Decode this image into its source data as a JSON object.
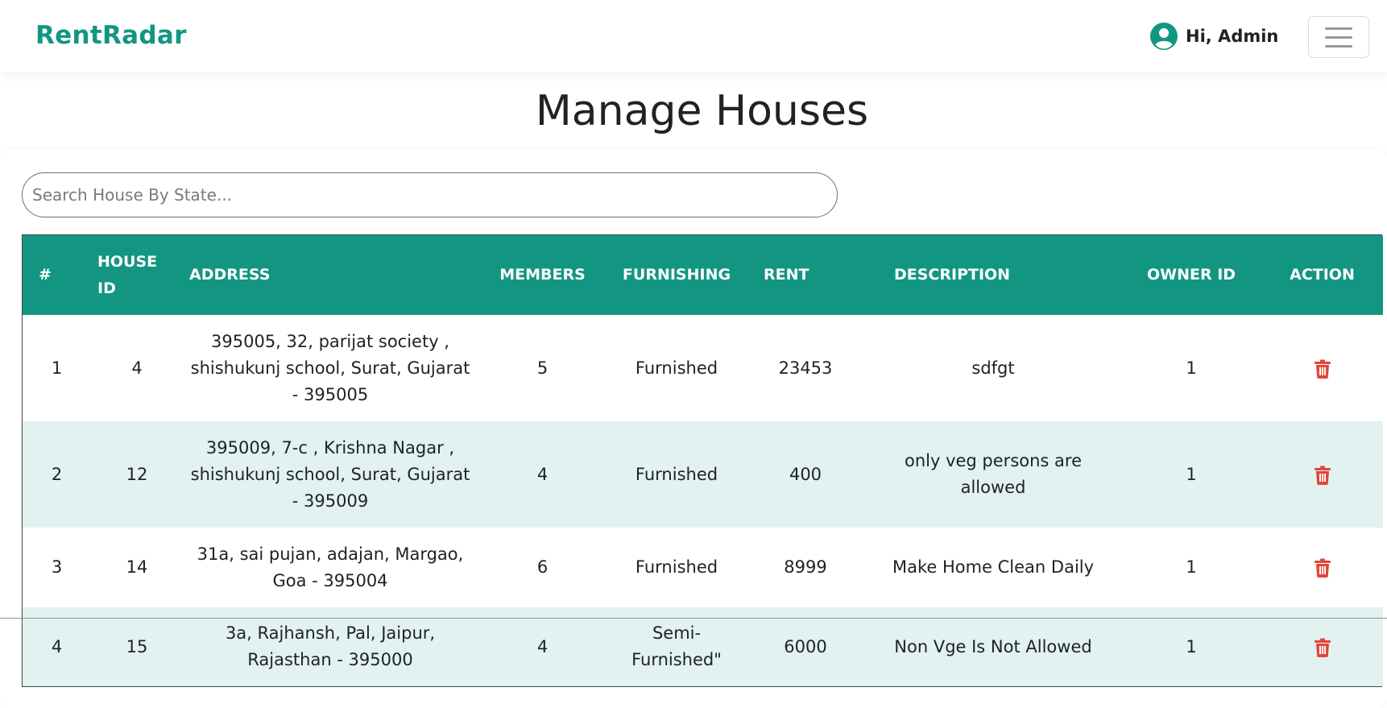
{
  "navbar": {
    "brand": "RentRadar",
    "greeting": "Hi, Admin",
    "user_icon": "user-circle-icon",
    "menu_icon": "hamburger-icon"
  },
  "page": {
    "title": "Manage Houses"
  },
  "search": {
    "placeholder": "Search House By State...",
    "value": ""
  },
  "table": {
    "headers": [
      "#",
      "HOUSE ID",
      "ADDRESS",
      "MEMBERS",
      "FURNISHING",
      "RENT",
      "DESCRIPTION",
      "OWNER ID",
      "ACTION"
    ],
    "rows": [
      {
        "num": "1",
        "house_id": "4",
        "address": "395005, 32, parijat society , shishukunj school, Surat, Gujarat - 395005",
        "members": "5",
        "furnishing": "Furnished",
        "rent": "23453",
        "description": "sdfgt",
        "owner_id": "1",
        "action_icon": "trash-icon"
      },
      {
        "num": "2",
        "house_id": "12",
        "address": "395009, 7-c , Krishna Nagar , shishukunj school, Surat, Gujarat - 395009",
        "members": "4",
        "furnishing": "Furnished",
        "rent": "400",
        "description": "only veg persons are allowed",
        "owner_id": "1",
        "action_icon": "trash-icon"
      },
      {
        "num": "3",
        "house_id": "14",
        "address": "31a, sai pujan, adajan, Margao, Goa - 395004",
        "members": "6",
        "furnishing": "Furnished",
        "rent": "8999",
        "description": "Make Home Clean Daily",
        "owner_id": "1",
        "action_icon": "trash-icon"
      },
      {
        "num": "4",
        "house_id": "15",
        "address": "3a, Rajhansh, Pal, Jaipur, Rajasthan - 395000",
        "members": "4",
        "furnishing": "Semi-Furnished\"",
        "rent": "6000",
        "description": "Non Vge Is Not Allowed",
        "owner_id": "1",
        "action_icon": "trash-icon"
      }
    ]
  },
  "colors": {
    "brand": "#129682",
    "header_bg": "#129682",
    "row_alt_bg": "#e1f2f1",
    "delete_icon": "#e0463a"
  }
}
